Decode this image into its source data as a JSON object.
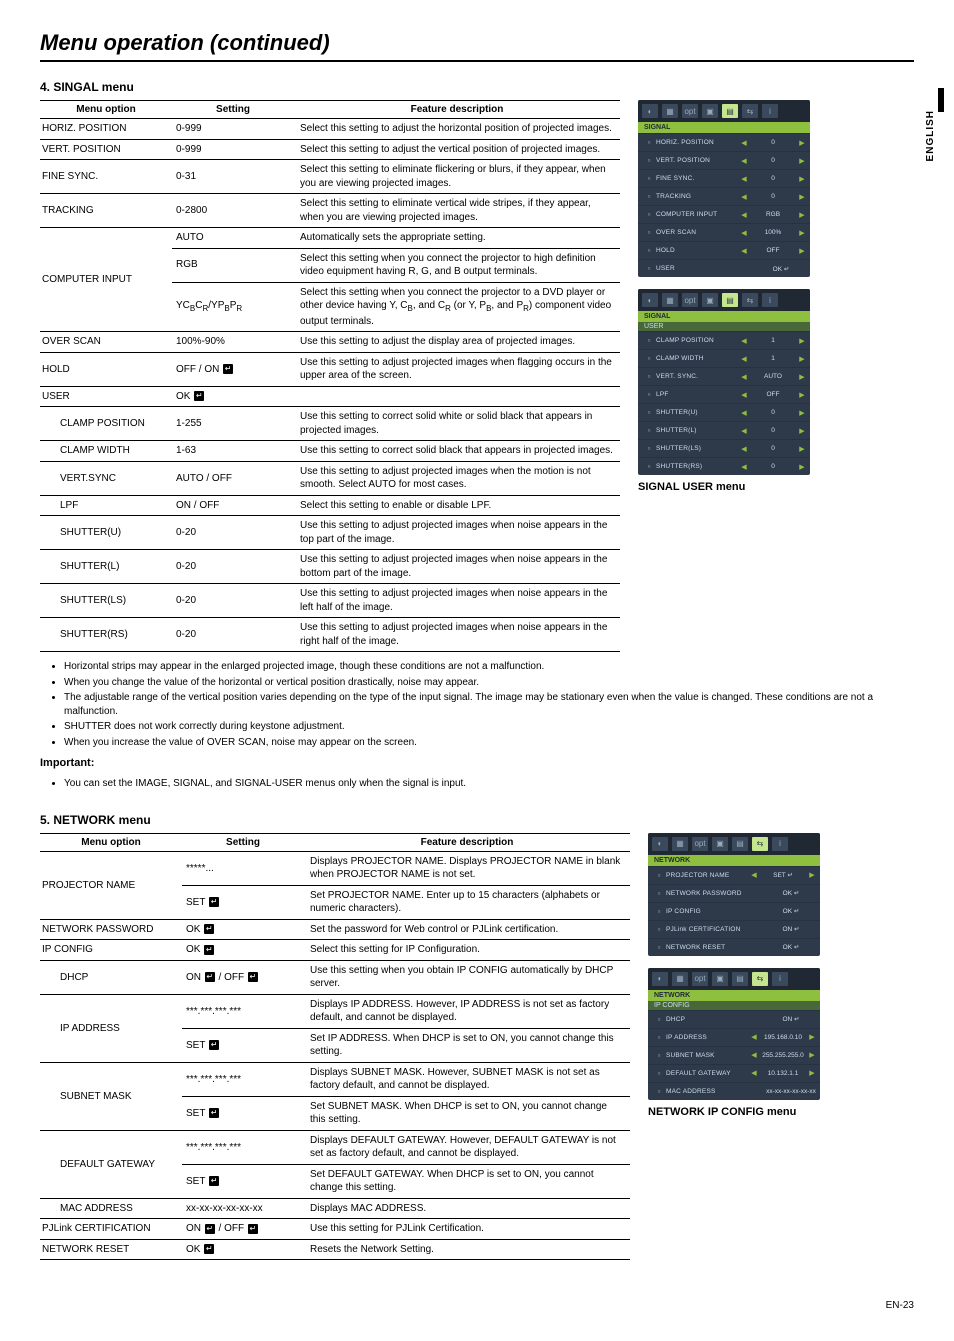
{
  "page": {
    "title": "Menu operation (continued)",
    "side_label": "ENGLISH",
    "page_number": "EN-23"
  },
  "signal_section": {
    "heading": "4. SINGAL menu",
    "columns": {
      "opt": "Menu option",
      "set": "Setting",
      "desc": "Feature description"
    },
    "rows": [
      {
        "opt": "HORIZ. POSITION",
        "set": "0-999",
        "desc": "Select this setting to adjust the horizontal position of projected images."
      },
      {
        "opt": "VERT. POSITION",
        "set": "0-999",
        "desc": "Select this setting to adjust the vertical position of projected images."
      },
      {
        "opt": "FINE SYNC.",
        "set": "0-31",
        "desc": "Select this setting to eliminate flickering or blurs, if they appear, when you are viewing projected images."
      },
      {
        "opt": "TRACKING",
        "set": "0-2800",
        "desc": "Select this setting to eliminate vertical wide stripes, if they appear, when you are viewing projected images."
      }
    ],
    "computer_input": {
      "opt": "COMPUTER INPUT",
      "sub": [
        {
          "set": "AUTO",
          "desc": "Automatically sets the appropriate setting."
        },
        {
          "set": "RGB",
          "desc": "Select this setting when you connect the projector to high definition video equipment having R, G, and B output terminals."
        },
        {
          "set_html": "YC<sub>B</sub>C<sub>R</sub>/YP<sub>B</sub>P<sub>R</sub>",
          "desc_html": "Select this setting when you connect the projector to a DVD player or other device having Y, C<sub>B</sub>, and C<sub>R</sub> (or Y, P<sub>B</sub>, and P<sub>R</sub>) component video output terminals."
        }
      ]
    },
    "rows2": [
      {
        "opt": "OVER SCAN",
        "set": "100%-90%",
        "desc": "Use this setting to adjust the display area of projected images."
      },
      {
        "opt": "HOLD",
        "set_html": "OFF / ON <span class='enter-icon'>↵</span>",
        "desc": "Use this setting to adjust projected images when flagging occurs in the upper area of the screen."
      },
      {
        "opt": "USER",
        "set_html": "OK <span class='enter-icon'>↵</span>",
        "desc": ""
      }
    ],
    "user_rows": [
      {
        "opt": "CLAMP POSITION",
        "set": "1-255",
        "desc": "Use this setting to correct solid white or solid black that appears in projected images."
      },
      {
        "opt": "CLAMP WIDTH",
        "set": "1-63",
        "desc": "Use this setting to correct solid black that appears in projected images."
      },
      {
        "opt": "VERT.SYNC",
        "set": "AUTO / OFF",
        "desc": "Use this setting to adjust projected images when the motion is not smooth. Select AUTO for most cases."
      },
      {
        "opt": "LPF",
        "set": "ON / OFF",
        "desc": "Select this setting to enable or disable LPF."
      },
      {
        "opt": "SHUTTER(U)",
        "set": "0-20",
        "desc": "Use this setting to adjust projected images when noise appears in the top part of the image."
      },
      {
        "opt": "SHUTTER(L)",
        "set": "0-20",
        "desc": "Use this setting to adjust projected images when noise appears in the bottom part of the image."
      },
      {
        "opt": "SHUTTER(LS)",
        "set": "0-20",
        "desc": "Use this setting to adjust projected images when noise appears in the left half of the image."
      },
      {
        "opt": "SHUTTER(RS)",
        "set": "0-20",
        "desc": "Use this setting to adjust projected images when noise appears in the right half of the image."
      }
    ],
    "notes": [
      "Horizontal strips may appear in the enlarged projected image, though these conditions are not a malfunction.",
      "When you change the value of the horizontal or vertical position drastically, noise may appear.",
      "The adjustable range of the vertical position varies depending on the type of the input signal. The image may be stationary even when the value is changed. These conditions are not a malfunction.",
      "SHUTTER does not work correctly during keystone adjustment.",
      "When you increase the value of OVER SCAN, noise may appear on the screen."
    ],
    "important_label": "Important:",
    "important_notes": [
      "You can set the IMAGE, SIGNAL, and SIGNAL-USER menus only when the signal is input."
    ]
  },
  "osd_signal": {
    "header": "SIGNAL",
    "rows": [
      {
        "lbl": "HORIZ. POSITION",
        "val": "0"
      },
      {
        "lbl": "VERT. POSITION",
        "val": "0"
      },
      {
        "lbl": "FINE SYNC.",
        "val": "0"
      },
      {
        "lbl": "TRACKING",
        "val": "0"
      },
      {
        "lbl": "COMPUTER INPUT",
        "val": "RGB"
      },
      {
        "lbl": "OVER SCAN",
        "val": "100%"
      },
      {
        "lbl": "HOLD",
        "val": "OFF"
      },
      {
        "lbl": "USER",
        "val": "OK ↵",
        "noarr": true
      }
    ]
  },
  "osd_user": {
    "header": "SIGNAL",
    "sub": "USER",
    "rows": [
      {
        "lbl": "CLAMP POSITION",
        "val": "1"
      },
      {
        "lbl": "CLAMP WIDTH",
        "val": "1"
      },
      {
        "lbl": "VERT. SYNC.",
        "val": "AUTO"
      },
      {
        "lbl": "LPF",
        "val": "OFF"
      },
      {
        "lbl": "SHUTTER(U)",
        "val": "0"
      },
      {
        "lbl": "SHUTTER(L)",
        "val": "0"
      },
      {
        "lbl": "SHUTTER(LS)",
        "val": "0"
      },
      {
        "lbl": "SHUTTER(RS)",
        "val": "0"
      }
    ],
    "caption": "SIGNAL USER menu"
  },
  "network_section": {
    "heading": "5. NETWORK menu",
    "columns": {
      "opt": "Menu option",
      "set": "Setting",
      "desc": "Feature description"
    },
    "rows": [
      {
        "opt": "PROJECTOR NAME",
        "span": 2,
        "sub": [
          {
            "set": "*****...",
            "desc": "Displays PROJECTOR NAME. Displays PROJECTOR NAME in blank when PROJECTOR NAME is not set."
          },
          {
            "set_html": "SET <span class='enter-icon'>↵</span>",
            "desc": "Set PROJECTOR NAME. Enter up to 15 characters (alphabets or numeric characters)."
          }
        ]
      },
      {
        "opt": "NETWORK PASSWORD",
        "set_html": "OK <span class='enter-icon'>↵</span>",
        "desc": "Set the password for Web control or PJLink certification."
      },
      {
        "opt": "IP CONFIG",
        "set_html": "OK <span class='enter-icon'>↵</span>",
        "desc": "Select this setting for IP Configuration."
      },
      {
        "opt": "DHCP",
        "indent": true,
        "set_html": "ON <span class='enter-icon'>↵</span> / OFF <span class='enter-icon'>↵</span>",
        "desc": "Use this setting when you obtain IP CONFIG automatically by DHCP server."
      },
      {
        "opt": "IP ADDRESS",
        "indent": true,
        "span": 2,
        "sub": [
          {
            "set": "***.***.***.***",
            "desc": "Displays IP ADDRESS. However, IP ADDRESS is not set as factory default, and cannot be displayed."
          },
          {
            "set_html": "SET <span class='enter-icon'>↵</span>",
            "desc": "Set IP ADDRESS. When DHCP is set to ON, you cannot change this setting."
          }
        ]
      },
      {
        "opt": "SUBNET MASK",
        "indent": true,
        "span": 2,
        "sub": [
          {
            "set": "***.***.***.***",
            "desc": "Displays SUBNET MASK. However, SUBNET MASK is not set as factory default, and cannot be displayed."
          },
          {
            "set_html": "SET <span class='enter-icon'>↵</span>",
            "desc": "Set SUBNET MASK. When DHCP is set to ON, you cannot change this setting."
          }
        ]
      },
      {
        "opt": "DEFAULT GATEWAY",
        "indent": true,
        "span": 2,
        "sub": [
          {
            "set": "***.***.***.***",
            "desc": "Displays DEFAULT GATEWAY. However, DEFAULT GATEWAY is not set as factory default, and cannot be displayed."
          },
          {
            "set_html": "SET <span class='enter-icon'>↵</span>",
            "desc": "Set DEFAULT GATEWAY. When DHCP is set to ON, you cannot change this setting."
          }
        ]
      },
      {
        "opt": "MAC ADDRESS",
        "indent": true,
        "set": "xx-xx-xx-xx-xx-xx",
        "desc": "Displays MAC ADDRESS."
      },
      {
        "opt": "PJLink CERTIFICATION",
        "set_html": "ON <span class='enter-icon'>↵</span> / OFF <span class='enter-icon'>↵</span>",
        "desc": "Use this setting for PJLink Certification."
      },
      {
        "opt": "NETWORK RESET",
        "set_html": "OK <span class='enter-icon'>↵</span>",
        "desc": "Resets the Network Setting."
      }
    ]
  },
  "osd_network": {
    "header": "NETWORK",
    "rows": [
      {
        "lbl": "PROJECTOR NAME",
        "val": "SET ↵"
      },
      {
        "lbl": "NETWORK PASSWORD",
        "val": "OK ↵",
        "noarr": true
      },
      {
        "lbl": "IP CONFIG",
        "val": "OK ↵",
        "noarr": true
      },
      {
        "lbl": "PJLink CERTIFICATION",
        "val": "ON ↵",
        "noarr": true
      },
      {
        "lbl": "NETWORK RESET",
        "val": "OK ↵",
        "noarr": true
      }
    ]
  },
  "osd_ipconfig": {
    "header": "NETWORK",
    "sub": "IP CONFIG",
    "rows": [
      {
        "lbl": "DHCP",
        "val": "ON ↵",
        "noarr": true
      },
      {
        "lbl": "IP ADDRESS",
        "val": "195.168.0.10"
      },
      {
        "lbl": "SUBNET MASK",
        "val": "255.255.255.0"
      },
      {
        "lbl": "DEFAULT GATEWAY",
        "val": "10.132.1.1"
      },
      {
        "lbl": "MAC ADDRESS",
        "val": "xx-xx-xx-xx-xx-xx",
        "noarr": true
      }
    ],
    "caption": "NETWORK IP CONFIG menu"
  }
}
